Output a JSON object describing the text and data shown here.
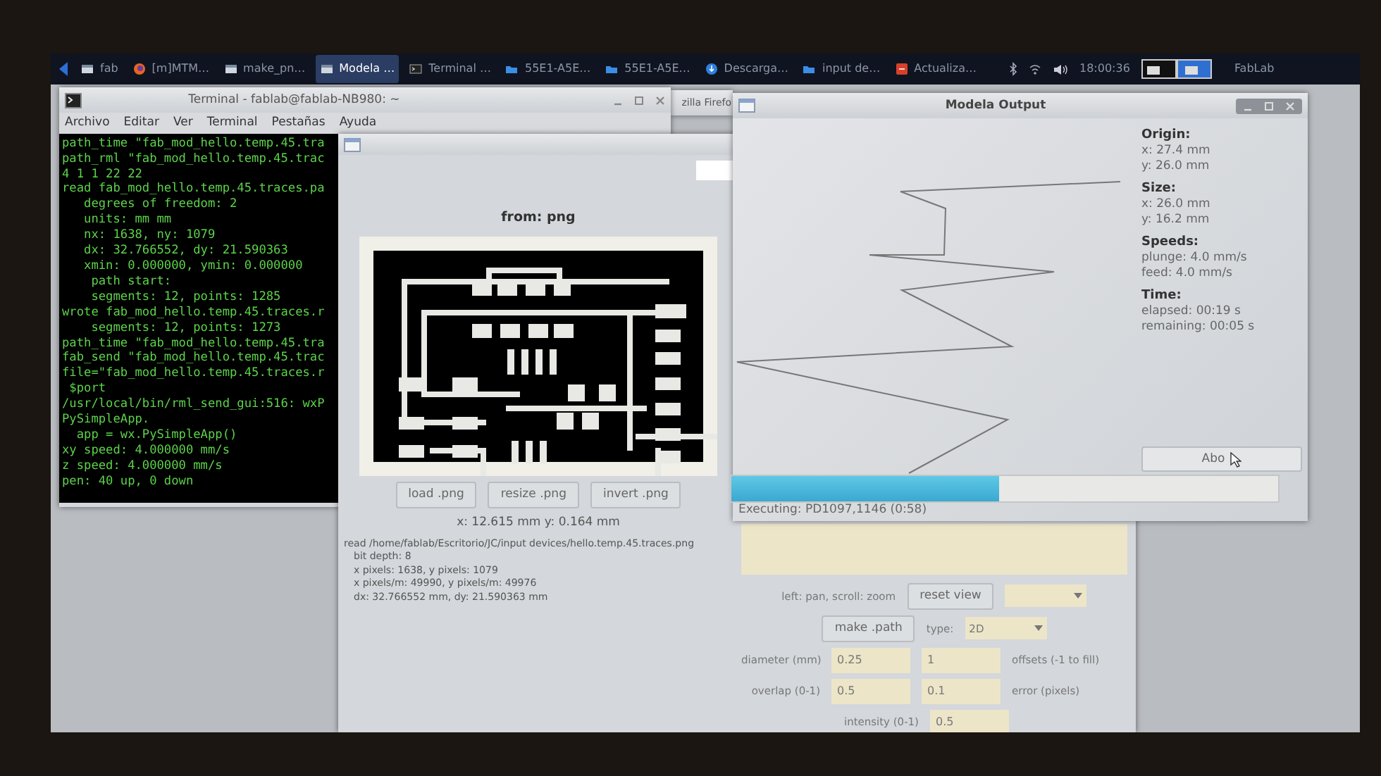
{
  "taskbar": {
    "items": [
      {
        "label": "fab",
        "kind": "window",
        "selected": false
      },
      {
        "label": "[m]MTM…",
        "kind": "browser",
        "selected": false
      },
      {
        "label": "make_pn…",
        "kind": "window",
        "selected": false
      },
      {
        "label": "Modela …",
        "kind": "window",
        "selected": true
      },
      {
        "label": "Terminal …",
        "kind": "terminal",
        "selected": false
      },
      {
        "label": "55E1-A5E…",
        "kind": "folder",
        "selected": false
      },
      {
        "label": "55E1-A5E…",
        "kind": "folder",
        "selected": false
      },
      {
        "label": "Descarga…",
        "kind": "download",
        "selected": false
      },
      {
        "label": "input de…",
        "kind": "folder",
        "selected": false
      },
      {
        "label": "Actualiza…",
        "kind": "updater",
        "selected": false
      }
    ],
    "clock": "18:00:36",
    "user": "FabLab"
  },
  "terminal": {
    "title": "Terminal - fablab@fablab-NB980: ~",
    "menu": [
      "Archivo",
      "Editar",
      "Ver",
      "Terminal",
      "Pestañas",
      "Ayuda"
    ],
    "lines": [
      "path_time \"fab_mod_hello.temp.45.tra",
      "path_rml \"fab_mod_hello.temp.45.trac",
      "4 1 1 22 22",
      "read fab_mod_hello.temp.45.traces.pa",
      "   degrees of freedom: 2",
      "   units: mm mm",
      "   nx: 1638, ny: 1079",
      "   dx: 32.766552, dy: 21.590363",
      "   xmin: 0.000000, ymin: 0.000000",
      "    path start:",
      "    segments: 12, points: 1285",
      "wrote fab_mod_hello.temp.45.traces.r",
      "    segments: 12, points: 1273",
      "path_time \"fab_mod_hello.temp.45.tra",
      "fab_send \"fab_mod_hello.temp.45.trac",
      "file=\"fab_mod_hello.temp.45.traces.r",
      " $port",
      "/usr/local/bin/rml_send_gui:516: wxP",
      "PySimpleApp.",
      "  app = wx.PySimpleApp()",
      "xy speed: 4.000000 mm/s",
      "z speed: 4.000000 mm/s",
      "pen: 40 up, 0 down"
    ]
  },
  "browser_window": {
    "title": "zilla Firefo"
  },
  "fab_window": {
    "heading": "from: png",
    "buttons": [
      "load .png",
      "resize .png",
      "invert .png"
    ],
    "coords": "x: 12.615 mm  y: 0.164 mm",
    "info_lines": [
      "read /home/fablab/Escritorio/JC/input devices/hello.temp.45.traces.png",
      "bit depth: 8",
      "x pixels: 1638, y pixels: 1079",
      "x pixels/m: 49990, y pixels/m: 49976",
      "dx: 32.766552 mm, dy: 21.590363 mm"
    ],
    "view_hint": "left: pan, scroll: zoom",
    "reset_button": "reset view",
    "path_button": "make .path",
    "type_label": "type:",
    "type_value": "2D",
    "parameter_rows": [
      {
        "label": "diameter (mm)",
        "value": "0.25",
        "value_2": "1",
        "label_2": "offsets (-1 to fill)"
      },
      {
        "label": "overlap (0-1)",
        "value": "0.5",
        "value_2": "0.1",
        "label_2": "error (pixels)"
      }
    ],
    "intensity": {
      "label": "intensity (0-1)",
      "value": "0.5"
    }
  },
  "modela": {
    "title": "Modela Output",
    "stats": [
      {
        "heading": "Origin:",
        "lines": [
          "x: 27.4 mm",
          "y: 26.0 mm"
        ]
      },
      {
        "heading": "Size:",
        "lines": [
          "x: 26.0 mm",
          "y: 16.2 mm"
        ]
      },
      {
        "heading": "Speeds:",
        "lines": [
          "plunge: 4.0 mm/s",
          "feed: 4.0 mm/s"
        ]
      },
      {
        "heading": "Time:",
        "lines": [
          "elapsed: 00:19 s",
          "remaining: 00:05 s"
        ]
      }
    ],
    "abort_button": "Abo",
    "progress": {
      "level": 0.49
    },
    "status": "Executing: PD1097,1146 (0:58)"
  }
}
